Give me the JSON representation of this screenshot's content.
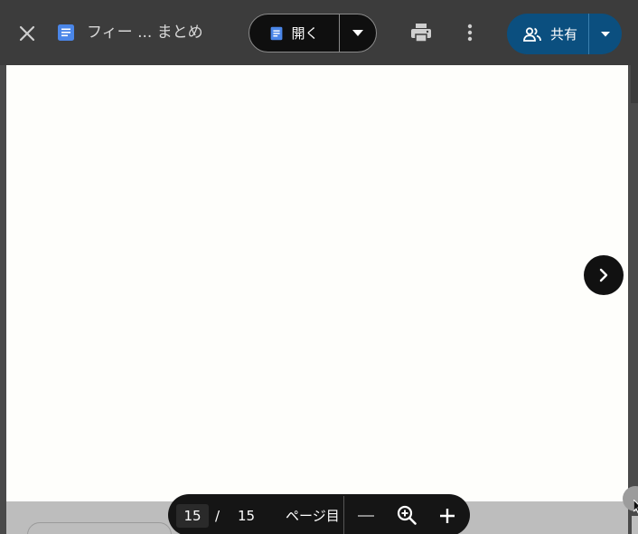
{
  "header": {
    "close_icon": "close-icon",
    "doc_icon": "google-docs-icon",
    "title": "フィー ... まとめ",
    "open_label": "開く",
    "open_icon": "google-docs-icon",
    "open_dropdown_icon": "caret-down-icon",
    "print_icon": "printer-icon",
    "more_icon": "more-vert-icon",
    "share_label": "共有",
    "share_icon": "people-icon",
    "share_dropdown_icon": "caret-down-icon"
  },
  "navigation": {
    "next_icon": "chevron-right-icon"
  },
  "pagination": {
    "current_page": "15",
    "separator": "/",
    "total_pages": "15",
    "unit_label": "ページ目"
  },
  "zoom": {
    "zoom_out_icon": "minus-icon",
    "zoom_fit_icon": "magnifier-plus-icon",
    "zoom_in_icon": "plus-icon"
  },
  "colors": {
    "topbar_bg": "#3c3c3c",
    "open_button_bg": "#0f0f0f",
    "share_button_bg": "#0b4f7f",
    "page_bg": "#fefefb",
    "docs_blue": "#4a86e8"
  }
}
